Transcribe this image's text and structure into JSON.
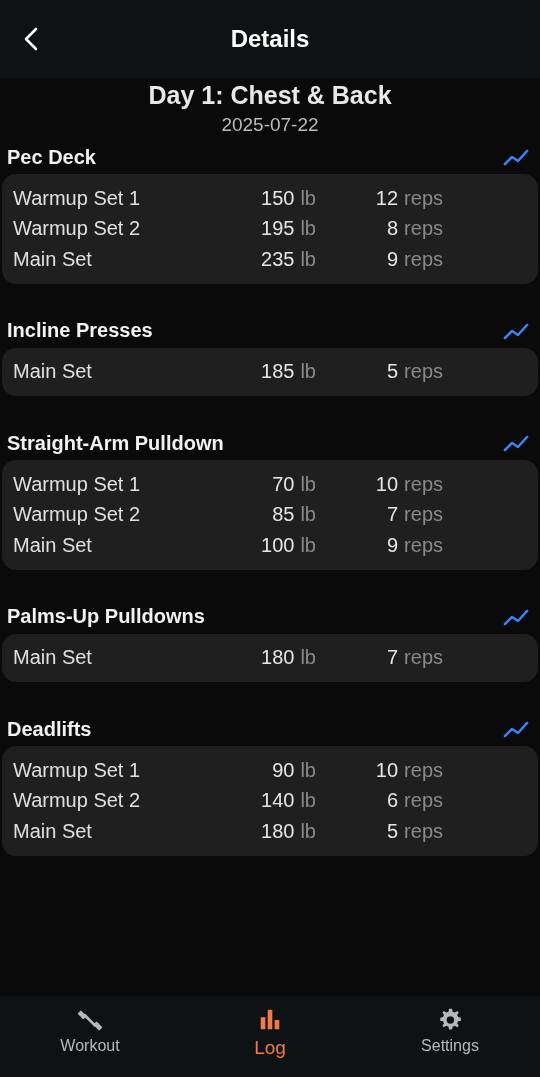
{
  "header": {
    "title": "Details"
  },
  "workout": {
    "title": "Day 1: Chest & Back",
    "date": "2025-07-22"
  },
  "exercises": [
    {
      "name": "Pec Deck",
      "sets": [
        {
          "label": "Warmup Set 1",
          "weight": "150",
          "weight_unit": "lb",
          "reps": "12",
          "reps_unit": "reps"
        },
        {
          "label": "Warmup Set 2",
          "weight": "195",
          "weight_unit": "lb",
          "reps": "8",
          "reps_unit": "reps"
        },
        {
          "label": "Main Set",
          "weight": "235",
          "weight_unit": "lb",
          "reps": "9",
          "reps_unit": "reps"
        }
      ]
    },
    {
      "name": "Incline Presses",
      "sets": [
        {
          "label": "Main Set",
          "weight": "185",
          "weight_unit": "lb",
          "reps": "5",
          "reps_unit": "reps"
        }
      ]
    },
    {
      "name": "Straight-Arm Pulldown",
      "sets": [
        {
          "label": "Warmup Set 1",
          "weight": "70",
          "weight_unit": "lb",
          "reps": "10",
          "reps_unit": "reps"
        },
        {
          "label": "Warmup Set 2",
          "weight": "85",
          "weight_unit": "lb",
          "reps": "7",
          "reps_unit": "reps"
        },
        {
          "label": "Main Set",
          "weight": "100",
          "weight_unit": "lb",
          "reps": "9",
          "reps_unit": "reps"
        }
      ]
    },
    {
      "name": "Palms-Up Pulldowns",
      "sets": [
        {
          "label": "Main Set",
          "weight": "180",
          "weight_unit": "lb",
          "reps": "7",
          "reps_unit": "reps"
        }
      ]
    },
    {
      "name": "Deadlifts",
      "sets": [
        {
          "label": "Warmup Set 1",
          "weight": "90",
          "weight_unit": "lb",
          "reps": "10",
          "reps_unit": "reps"
        },
        {
          "label": "Warmup Set 2",
          "weight": "140",
          "weight_unit": "lb",
          "reps": "6",
          "reps_unit": "reps"
        },
        {
          "label": "Main Set",
          "weight": "180",
          "weight_unit": "lb",
          "reps": "5",
          "reps_unit": "reps"
        }
      ]
    }
  ],
  "tab_bar": [
    {
      "kind": "workout",
      "label": "Workout",
      "selected": false
    },
    {
      "kind": "log",
      "label": "Log",
      "selected": true
    },
    {
      "kind": "settings",
      "label": "Settings",
      "selected": false
    }
  ]
}
